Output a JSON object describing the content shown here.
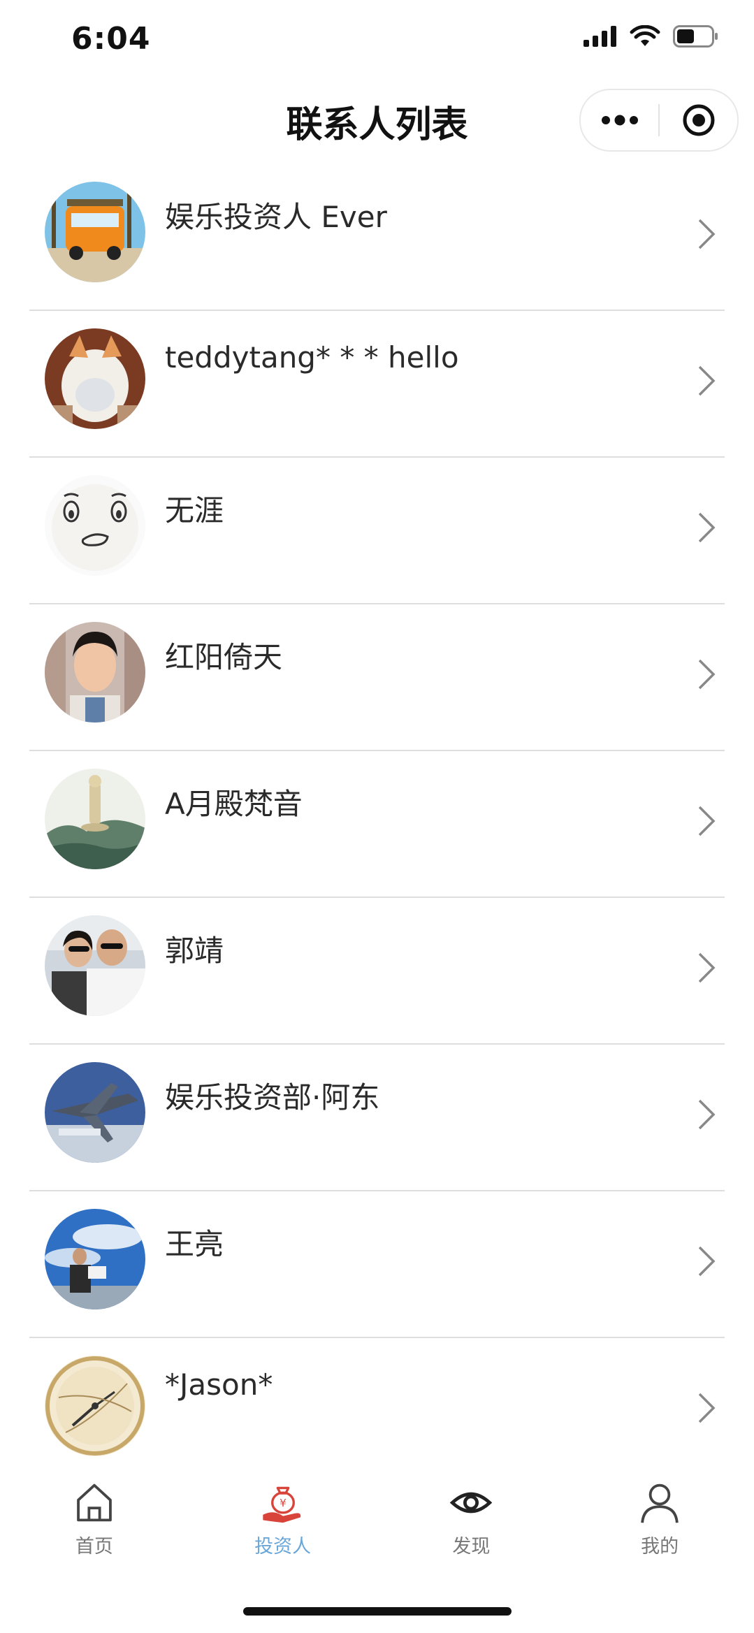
{
  "status_bar": {
    "time": "6:04",
    "icons": [
      "signal-icon",
      "wifi-icon",
      "battery-icon"
    ]
  },
  "nav": {
    "title": "联系人列表",
    "more_icon": "more-dots-icon",
    "close_icon": "target-icon"
  },
  "contacts": [
    {
      "name": "娱乐投资人 Ever",
      "avatar": "orange-van-photo"
    },
    {
      "name": "teddytang* * * hello",
      "avatar": "cat-photo"
    },
    {
      "name": "无涯",
      "avatar": "cartoon-face"
    },
    {
      "name": "红阳倚天",
      "avatar": "man-portrait"
    },
    {
      "name": "A月殿梵音",
      "avatar": "guanyin-statue"
    },
    {
      "name": "郭靖",
      "avatar": "couple-photo"
    },
    {
      "name": "娱乐投资部·阿东",
      "avatar": "jet-plane"
    },
    {
      "name": "王亮",
      "avatar": "man-sky-photo"
    },
    {
      "name": "*Jason*",
      "avatar": "clock-face"
    }
  ],
  "tabs": [
    {
      "label": "首页",
      "icon": "home-icon",
      "active": false
    },
    {
      "label": "投资人",
      "icon": "money-bag-hand-icon",
      "active": true
    },
    {
      "label": "发现",
      "icon": "eye-icon",
      "active": false
    },
    {
      "label": "我的",
      "icon": "user-icon",
      "active": false
    }
  ],
  "colors": {
    "active_tab": "#6aa7d8",
    "accent_red": "#d9443a",
    "divider": "#dedede"
  }
}
